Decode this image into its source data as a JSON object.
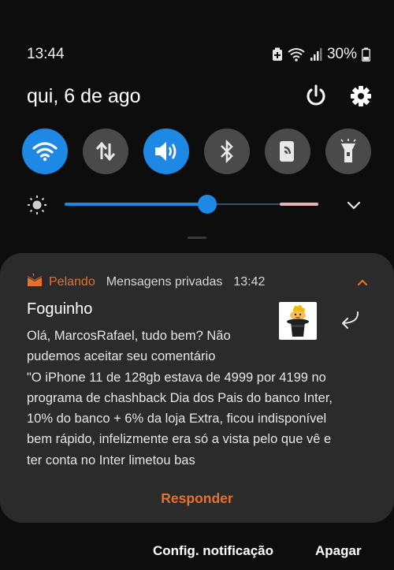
{
  "status_bar": {
    "time": "13:44",
    "battery_percent": "30%",
    "icons": [
      "battery-saver-icon",
      "wifi-icon",
      "signal-icon",
      "battery-icon"
    ]
  },
  "panel": {
    "date": "qui, 6 de ago",
    "icons": [
      "power-icon",
      "gear-icon"
    ]
  },
  "quick_toggles": [
    {
      "name": "wifi",
      "state": "on",
      "icon": "wifi-icon"
    },
    {
      "name": "mobile-data",
      "state": "off",
      "icon": "data-arrows-icon"
    },
    {
      "name": "sound",
      "state": "on",
      "icon": "speaker-icon"
    },
    {
      "name": "bluetooth",
      "state": "off",
      "icon": "bluetooth-icon"
    },
    {
      "name": "screen-rotation",
      "state": "off",
      "icon": "rotate-icon"
    },
    {
      "name": "flashlight",
      "state": "off",
      "icon": "flashlight-icon"
    }
  ],
  "brightness": {
    "level": 0.56,
    "colors": {
      "fill": "#1e88e5",
      "track": "#37506b",
      "hot": "#e8b4b4"
    }
  },
  "notification": {
    "app": "Pelando",
    "channel": "Mensagens privadas",
    "time": "13:42",
    "title": "Foguinho",
    "body_lines": [
      "Olá, MarcosRafael, tudo bem? Não",
      "pudemos aceitar seu comentário",
      "\"O iPhone 11 de 128gb estava de 4999 por 4199 no",
      "programa de chashback Dia dos Pais do banco Inter,",
      "10% do banco + 6% da loja Extra, ficou indisponível",
      "bem rápido, infelizmente era só a vista pelo que vê e",
      "ter conta no Inter limetou bas"
    ],
    "reply_label": "Responder",
    "accent_color": "#e8702a"
  },
  "footer": {
    "settings_label": "Config. notificação",
    "clear_label": "Apagar"
  }
}
